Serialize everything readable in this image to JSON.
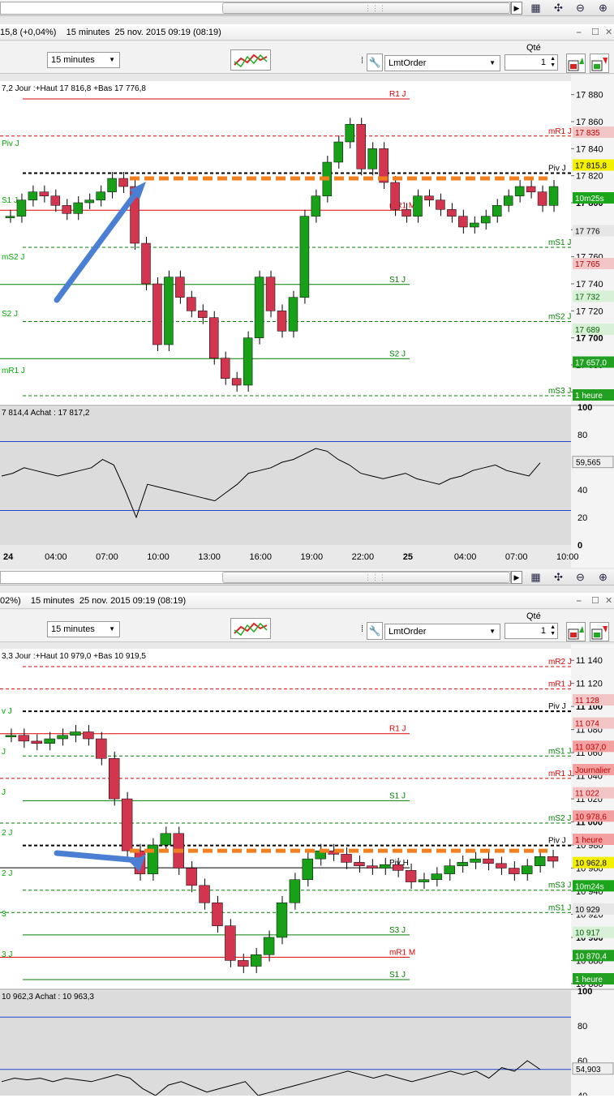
{
  "top": {
    "header_text": "15,8 (+0,04%)    15 minutes  25 nov. 2015 09:19 (08:19)",
    "timeframe": "15 minutes",
    "order_type": "LmtOrder",
    "qty_label": "Qté",
    "qty_value": "1",
    "info_line": "7,2 Jour :+Haut 17 816,8 +Bas 17 776,8",
    "indicator_line": "7 814,4 Achat : 17 817,2",
    "y_ticks": [
      "17 880",
      "17 860",
      "17 840",
      "17 820",
      "17 800",
      "17 780",
      "17 760",
      "17 740",
      "17 720",
      "17 700",
      "17 680",
      "17 660"
    ],
    "ind_ticks": [
      "100",
      "80",
      "60",
      "40",
      "20",
      "0"
    ],
    "ind_value": "59,565",
    "x_ticks": [
      "24",
      "04:00",
      "07:00",
      "10:00",
      "13:00",
      "16:00",
      "19:00",
      "22:00",
      "25",
      "04:00",
      "07:00",
      "10:00"
    ],
    "levels": [
      {
        "label": "R1 J",
        "color": "#e00000",
        "dash": false
      },
      {
        "label": "mR1 J",
        "color": "#e00000",
        "dash": true
      },
      {
        "label": "Piv J",
        "color": "#000000",
        "dash": true
      },
      {
        "label": "mR1 M",
        "color": "#e00000",
        "dash": false
      },
      {
        "label": "mS1 J",
        "color": "#008000",
        "dash": true
      },
      {
        "label": "S1 J",
        "color": "#008000",
        "dash": false
      },
      {
        "label": "mS2 J",
        "color": "#008000",
        "dash": true
      },
      {
        "label": "S2 J",
        "color": "#008000",
        "dash": false
      },
      {
        "label": "mS3 J",
        "color": "#008000",
        "dash": true
      }
    ],
    "left_labels": [
      "Piv J",
      "S1 J",
      "mS2 J",
      "S2 J",
      "mR1 J"
    ],
    "price_tags": [
      {
        "text": "17 835",
        "bg": "#f2c6c6",
        "fg": "#c00000"
      },
      {
        "text": "17 815,8",
        "bg": "#f3f000",
        "fg": "#000000"
      },
      {
        "text": "10m25s",
        "bg": "#1aa51a",
        "fg": "#ffffff"
      },
      {
        "text": "17 776",
        "bg": "#e6e6e6",
        "fg": "#000000"
      },
      {
        "text": "17 765",
        "bg": "#f2c6c6",
        "fg": "#c00000"
      },
      {
        "text": "17 732",
        "bg": "#d7f0d7",
        "fg": "#006400"
      },
      {
        "text": "17 689",
        "bg": "#d7f0d7",
        "fg": "#006400"
      },
      {
        "text": "17 657,0",
        "bg": "#22a022",
        "fg": "#ffffff"
      },
      {
        "text": "1 heure",
        "bg": "#22a022",
        "fg": "#ffffff"
      }
    ]
  },
  "bottom": {
    "header_text": "02%)    15 minutes  25 nov. 2015 09:19 (08:19)",
    "timeframe": "15 minutes",
    "order_type": "LmtOrder",
    "qty_label": "Qté",
    "qty_value": "1",
    "info_line": "3,3 Jour :+Haut 10 979,0 +Bas 10 919,5",
    "indicator_line": "10 962,3 Achat : 10 963,3",
    "y_ticks": [
      "11 140",
      "11 120",
      "11 100",
      "11 080",
      "11 060",
      "11 040",
      "11 020",
      "11 000",
      "10 980",
      "10 960",
      "10 940",
      "10 920",
      "10 900",
      "10 880",
      "10 860"
    ],
    "ind_ticks": [
      "100",
      "80",
      "60",
      "40"
    ],
    "ind_value": "54,903",
    "levels": [
      {
        "label": "mR2 J",
        "color": "#e00000",
        "dash": true
      },
      {
        "label": "mR1 J",
        "color": "#e00000",
        "dash": true
      },
      {
        "label": "Piv J",
        "color": "#000000",
        "dash": true
      },
      {
        "label": "R1 J",
        "color": "#e00000",
        "dash": false
      },
      {
        "label": "mS1 J",
        "color": "#008000",
        "dash": true
      },
      {
        "label": "mR1 J",
        "color": "#e00000",
        "dash": true
      },
      {
        "label": "S1 J",
        "color": "#008000",
        "dash": false
      },
      {
        "label": "mS2 J",
        "color": "#008000",
        "dash": true
      },
      {
        "label": "Piv J",
        "color": "#000000",
        "dash": true
      },
      {
        "label": "Piv H",
        "color": "#000000",
        "dash": false
      },
      {
        "label": "mS3 J",
        "color": "#008000",
        "dash": true
      },
      {
        "label": "mS1 J",
        "color": "#008000",
        "dash": true
      },
      {
        "label": "S3 J",
        "color": "#008000",
        "dash": false
      },
      {
        "label": "mR1 M",
        "color": "#e00000",
        "dash": false
      },
      {
        "label": "S1 J",
        "color": "#008000",
        "dash": false
      }
    ],
    "left_labels": [
      "v J",
      "J",
      "J",
      "2 J",
      "2 J",
      "3",
      "3 J"
    ],
    "price_tags": [
      {
        "text": "11 128",
        "bg": "#f2c6c6",
        "fg": "#c00000"
      },
      {
        "text": "11 074",
        "bg": "#f2c6c6",
        "fg": "#c00000"
      },
      {
        "text": "11 037,0",
        "bg": "#f2a0a0",
        "fg": "#c00000"
      },
      {
        "text": "Journalier",
        "bg": "#f2a0a0",
        "fg": "#c00000"
      },
      {
        "text": "11 022",
        "bg": "#f2c6c6",
        "fg": "#c00000"
      },
      {
        "text": "10 978,6",
        "bg": "#f2a0a0",
        "fg": "#c00000"
      },
      {
        "text": "1 heure",
        "bg": "#f2a0a0",
        "fg": "#c00000"
      },
      {
        "text": "10 962,8",
        "bg": "#f3f000",
        "fg": "#000000"
      },
      {
        "text": "10m24s",
        "bg": "#1aa51a",
        "fg": "#ffffff"
      },
      {
        "text": "10 929",
        "bg": "#e6e6e6",
        "fg": "#000000"
      },
      {
        "text": "10 917",
        "bg": "#d7f0d7",
        "fg": "#006400"
      },
      {
        "text": "10 870,4",
        "bg": "#22a022",
        "fg": "#ffffff"
      },
      {
        "text": "1 heure",
        "bg": "#22a022",
        "fg": "#ffffff"
      }
    ]
  },
  "icons": [
    "scroll-icon",
    "zoom-fit-icon",
    "zoom-out-icon",
    "zoom-in-icon",
    "wrench-icon",
    "chart-style-icon",
    "buy-icon",
    "sell-icon",
    "restore-icon",
    "maximize-icon",
    "close-icon"
  ],
  "chart_data": [
    {
      "type": "line",
      "title": "",
      "x_tick_labels": [
        "24",
        "04:00",
        "07:00",
        "10:00",
        "13:00",
        "16:00",
        "19:00",
        "22:00",
        "25",
        "04:00",
        "07:00",
        "10:00"
      ],
      "ylim": [
        17650,
        17890
      ],
      "series": [
        {
          "values": [
            17790,
            17802,
            17808,
            17805,
            17798,
            17792,
            17800,
            17802,
            17808,
            17818,
            17812,
            17770,
            17740,
            17695,
            17745,
            17730,
            17720,
            17715,
            17685,
            17670,
            17665,
            17700,
            17745,
            17720,
            17705,
            17730,
            17790,
            17805,
            17830,
            17845,
            17858,
            17825,
            17840,
            17815,
            17795,
            17790,
            17805,
            17802,
            17795,
            17790,
            17782,
            17785,
            17790,
            17798,
            17805,
            17812,
            17808,
            17798,
            17812
          ]
        },
        {
          "name": "mR1 J",
          "values": [
            17835
          ]
        },
        {
          "name": "Piv J",
          "values": [
            17810
          ]
        },
        {
          "name": "mR1 M",
          "values": [
            17765
          ]
        },
        {
          "name": "S1 J",
          "values": [
            17750
          ]
        },
        {
          "name": "S2 J",
          "values": [
            17689
          ]
        },
        {
          "name": "mS3 J",
          "values": [
            17657
          ]
        }
      ]
    },
    {
      "type": "line",
      "title": "",
      "indicator_ylim": [
        0,
        100
      ],
      "series": [
        {
          "values": [
            50,
            52,
            56,
            54,
            52,
            50,
            52,
            54,
            56,
            62,
            58,
            40,
            20,
            44,
            42,
            40,
            38,
            36,
            34,
            32,
            38,
            44,
            52,
            54,
            56,
            60,
            62,
            66,
            70,
            68,
            62,
            58,
            52,
            50,
            48,
            50,
            52,
            48,
            46,
            44,
            48,
            50,
            54,
            56,
            58,
            54,
            52,
            50,
            59.6
          ]
        }
      ]
    },
    {
      "type": "line",
      "title": "",
      "ylim": [
        10855,
        11150
      ],
      "series": [
        {
          "values": [
            11075,
            11070,
            11068,
            11072,
            11075,
            11078,
            11072,
            11055,
            11020,
            10975,
            10955,
            10980,
            10990,
            10960,
            10945,
            10930,
            10910,
            10880,
            10875,
            10885,
            10900,
            10930,
            10950,
            10968,
            10975,
            10972,
            10965,
            10962,
            10960,
            10963,
            10958,
            10948,
            10950,
            10955,
            10962,
            10965,
            10968,
            10964,
            10960,
            10955,
            10962,
            10970,
            10966
          ]
        },
        {
          "name": "R1 J",
          "values": [
            11074
          ]
        },
        {
          "name": "Piv H",
          "values": [
            10929
          ]
        },
        {
          "name": "mS1 J",
          "values": [
            10917
          ]
        }
      ]
    },
    {
      "type": "line",
      "title": "",
      "indicator_ylim": [
        40,
        100
      ],
      "series": [
        {
          "values": [
            48,
            50,
            49,
            50,
            48,
            50,
            49,
            48,
            50,
            52,
            50,
            44,
            40,
            46,
            48,
            45,
            42,
            44,
            46,
            48,
            40,
            42,
            44,
            46,
            48,
            50,
            52,
            54,
            52,
            50,
            52,
            50,
            48,
            50,
            52,
            54,
            52,
            54,
            50,
            56,
            54,
            60,
            55
          ]
        }
      ]
    }
  ]
}
